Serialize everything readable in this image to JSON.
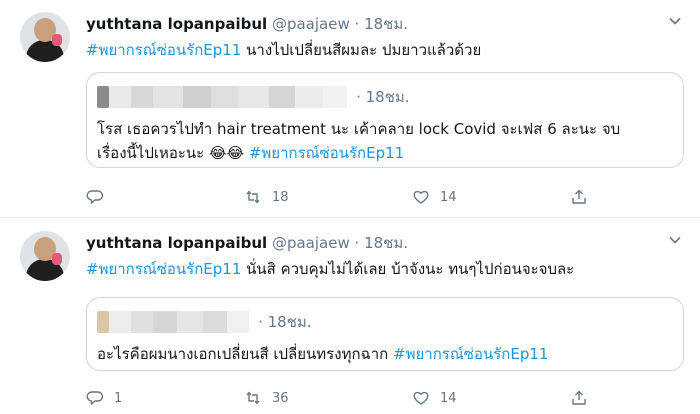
{
  "tweets": [
    {
      "name": "yuthtana lopanpaibul",
      "handle": "@paajaew",
      "dot": "·",
      "time": "18ชม.",
      "hashtag": "#พยากรณ์ซ่อนรักEp11",
      "text": "  นางไปเปลี่ยนสีผมละ  ปมยาวแล้วด้วย",
      "quote": {
        "time": "18ชม.",
        "line1": "โรส เธอควรไปทำ hair treatment นะ เค้าคลาย lock Covid จะเฟส 6 ละนะ จบ",
        "line2_text": "เรื่องนี้ไปเหอะนะ 😂😂 ",
        "line2_tag": "#พยากรณ์ซ่อนรักEp11"
      },
      "reply_count": "",
      "retweet_count": "18",
      "like_count": "14"
    },
    {
      "name": "yuthtana lopanpaibul",
      "handle": "@paajaew",
      "dot": "·",
      "time": "18ชม.",
      "hashtag": "#พยากรณ์ซ่อนรักEp11",
      "text": " นั่นสิ ควบคุมไม่ได้เลย บ้าจังนะ  ทนๆไปก่อนจะจบละ",
      "quote": {
        "time": "18ชม.",
        "line1_text": "อะไรคือผมนางเอกเปลี่ยนสี เปลี่ยนทรงทุกฉาก ",
        "line1_tag": "#พยากรณ์ซ่อนรักEp11"
      },
      "reply_count": "1",
      "retweet_count": "36",
      "like_count": "14"
    }
  ],
  "icons": {
    "reply": "reply-icon",
    "retweet": "retweet-icon",
    "like": "heart-icon",
    "share": "share-icon",
    "more": "chevron-down-icon"
  },
  "colors": {
    "link": "#1b95e0",
    "muted": "#657786",
    "border": "#ccd6dd"
  }
}
